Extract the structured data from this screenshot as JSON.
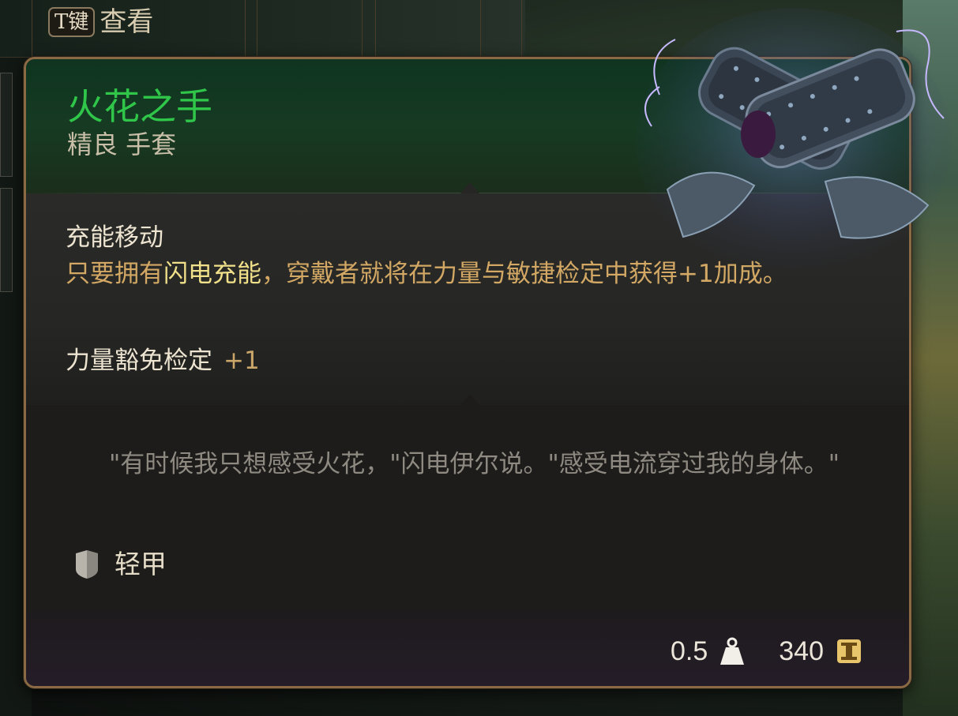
{
  "hotkey": {
    "key": "T键",
    "label": "查看"
  },
  "item": {
    "name": "火花之手",
    "rarity_type": "精良 手套",
    "rarity_color": "#2fc64a",
    "icon": "spark-gauntlets-icon"
  },
  "effect": {
    "title": "充能移动",
    "desc_part1": "只要拥有",
    "desc_highlight": "闪电充能",
    "desc_part2": "，穿戴者就将在力量与敏捷检定中获得+1加成。"
  },
  "save": {
    "label": "力量豁免检定",
    "bonus": "+1"
  },
  "quote": "\"有时候我只想感受火花，\"闪电伊尔说。\"感受电流穿过我的身体。\"",
  "armor": {
    "icon": "shield-icon",
    "type": "轻甲"
  },
  "footer": {
    "weight": "0.5",
    "weight_icon": "weight-icon",
    "price": "340",
    "price_icon": "gold-coin-icon"
  }
}
